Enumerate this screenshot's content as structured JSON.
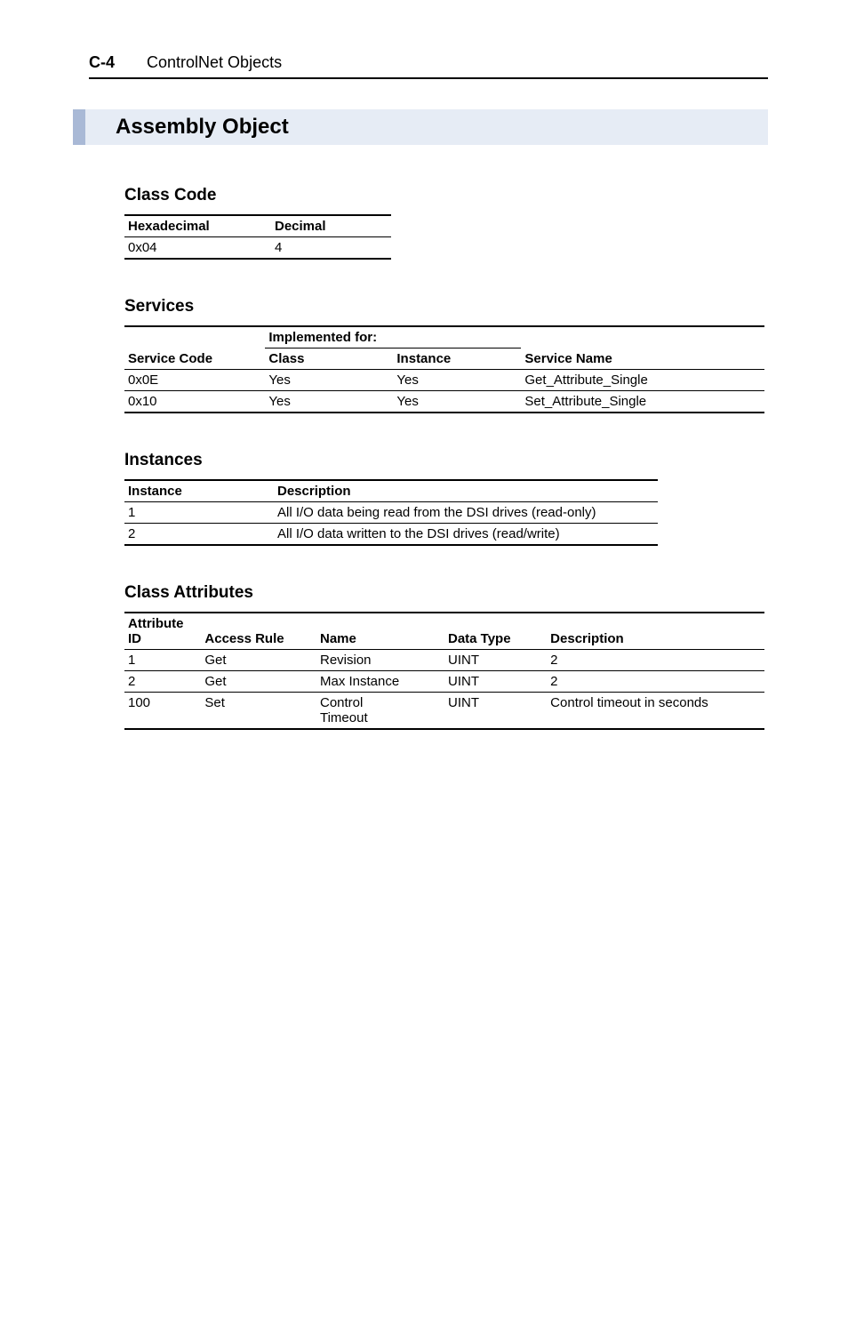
{
  "header": {
    "page_num": "C-4",
    "title": "ControlNet Objects"
  },
  "section_title": "Assembly Object",
  "class_code": {
    "heading": "Class Code",
    "cols": [
      "Hexadecimal",
      "Decimal"
    ],
    "row": [
      "0x04",
      "4"
    ]
  },
  "services": {
    "heading": "Services",
    "impl_label": "Implemented for:",
    "cols": [
      "Service Code",
      "Class",
      "Instance",
      "Service Name"
    ],
    "rows": [
      [
        "0x0E",
        "Yes",
        "Yes",
        "Get_Attribute_Single"
      ],
      [
        "0x10",
        "Yes",
        "Yes",
        "Set_Attribute_Single"
      ]
    ]
  },
  "instances": {
    "heading": "Instances",
    "cols": [
      "Instance",
      "Description"
    ],
    "rows": [
      [
        "1",
        "All I/O data being read from the DSI drives (read-only)"
      ],
      [
        "2",
        "All I/O data written to the DSI drives (read/write)"
      ]
    ]
  },
  "class_attributes": {
    "heading": "Class Attributes",
    "cols": [
      "Attribute ID",
      "Access Rule",
      "Name",
      "Data Type",
      "Description"
    ],
    "attr_id_l1": "Attribute",
    "attr_id_l2": "ID",
    "rows": [
      [
        "1",
        "Get",
        "Revision",
        "UINT",
        "2"
      ],
      [
        "2",
        "Get",
        "Max Instance",
        "UINT",
        "2"
      ],
      [
        "100",
        "Set",
        "Control Timeout",
        "UINT",
        "Control timeout in seconds"
      ]
    ],
    "ctl_l1": "Control",
    "ctl_l2": "Timeout"
  }
}
